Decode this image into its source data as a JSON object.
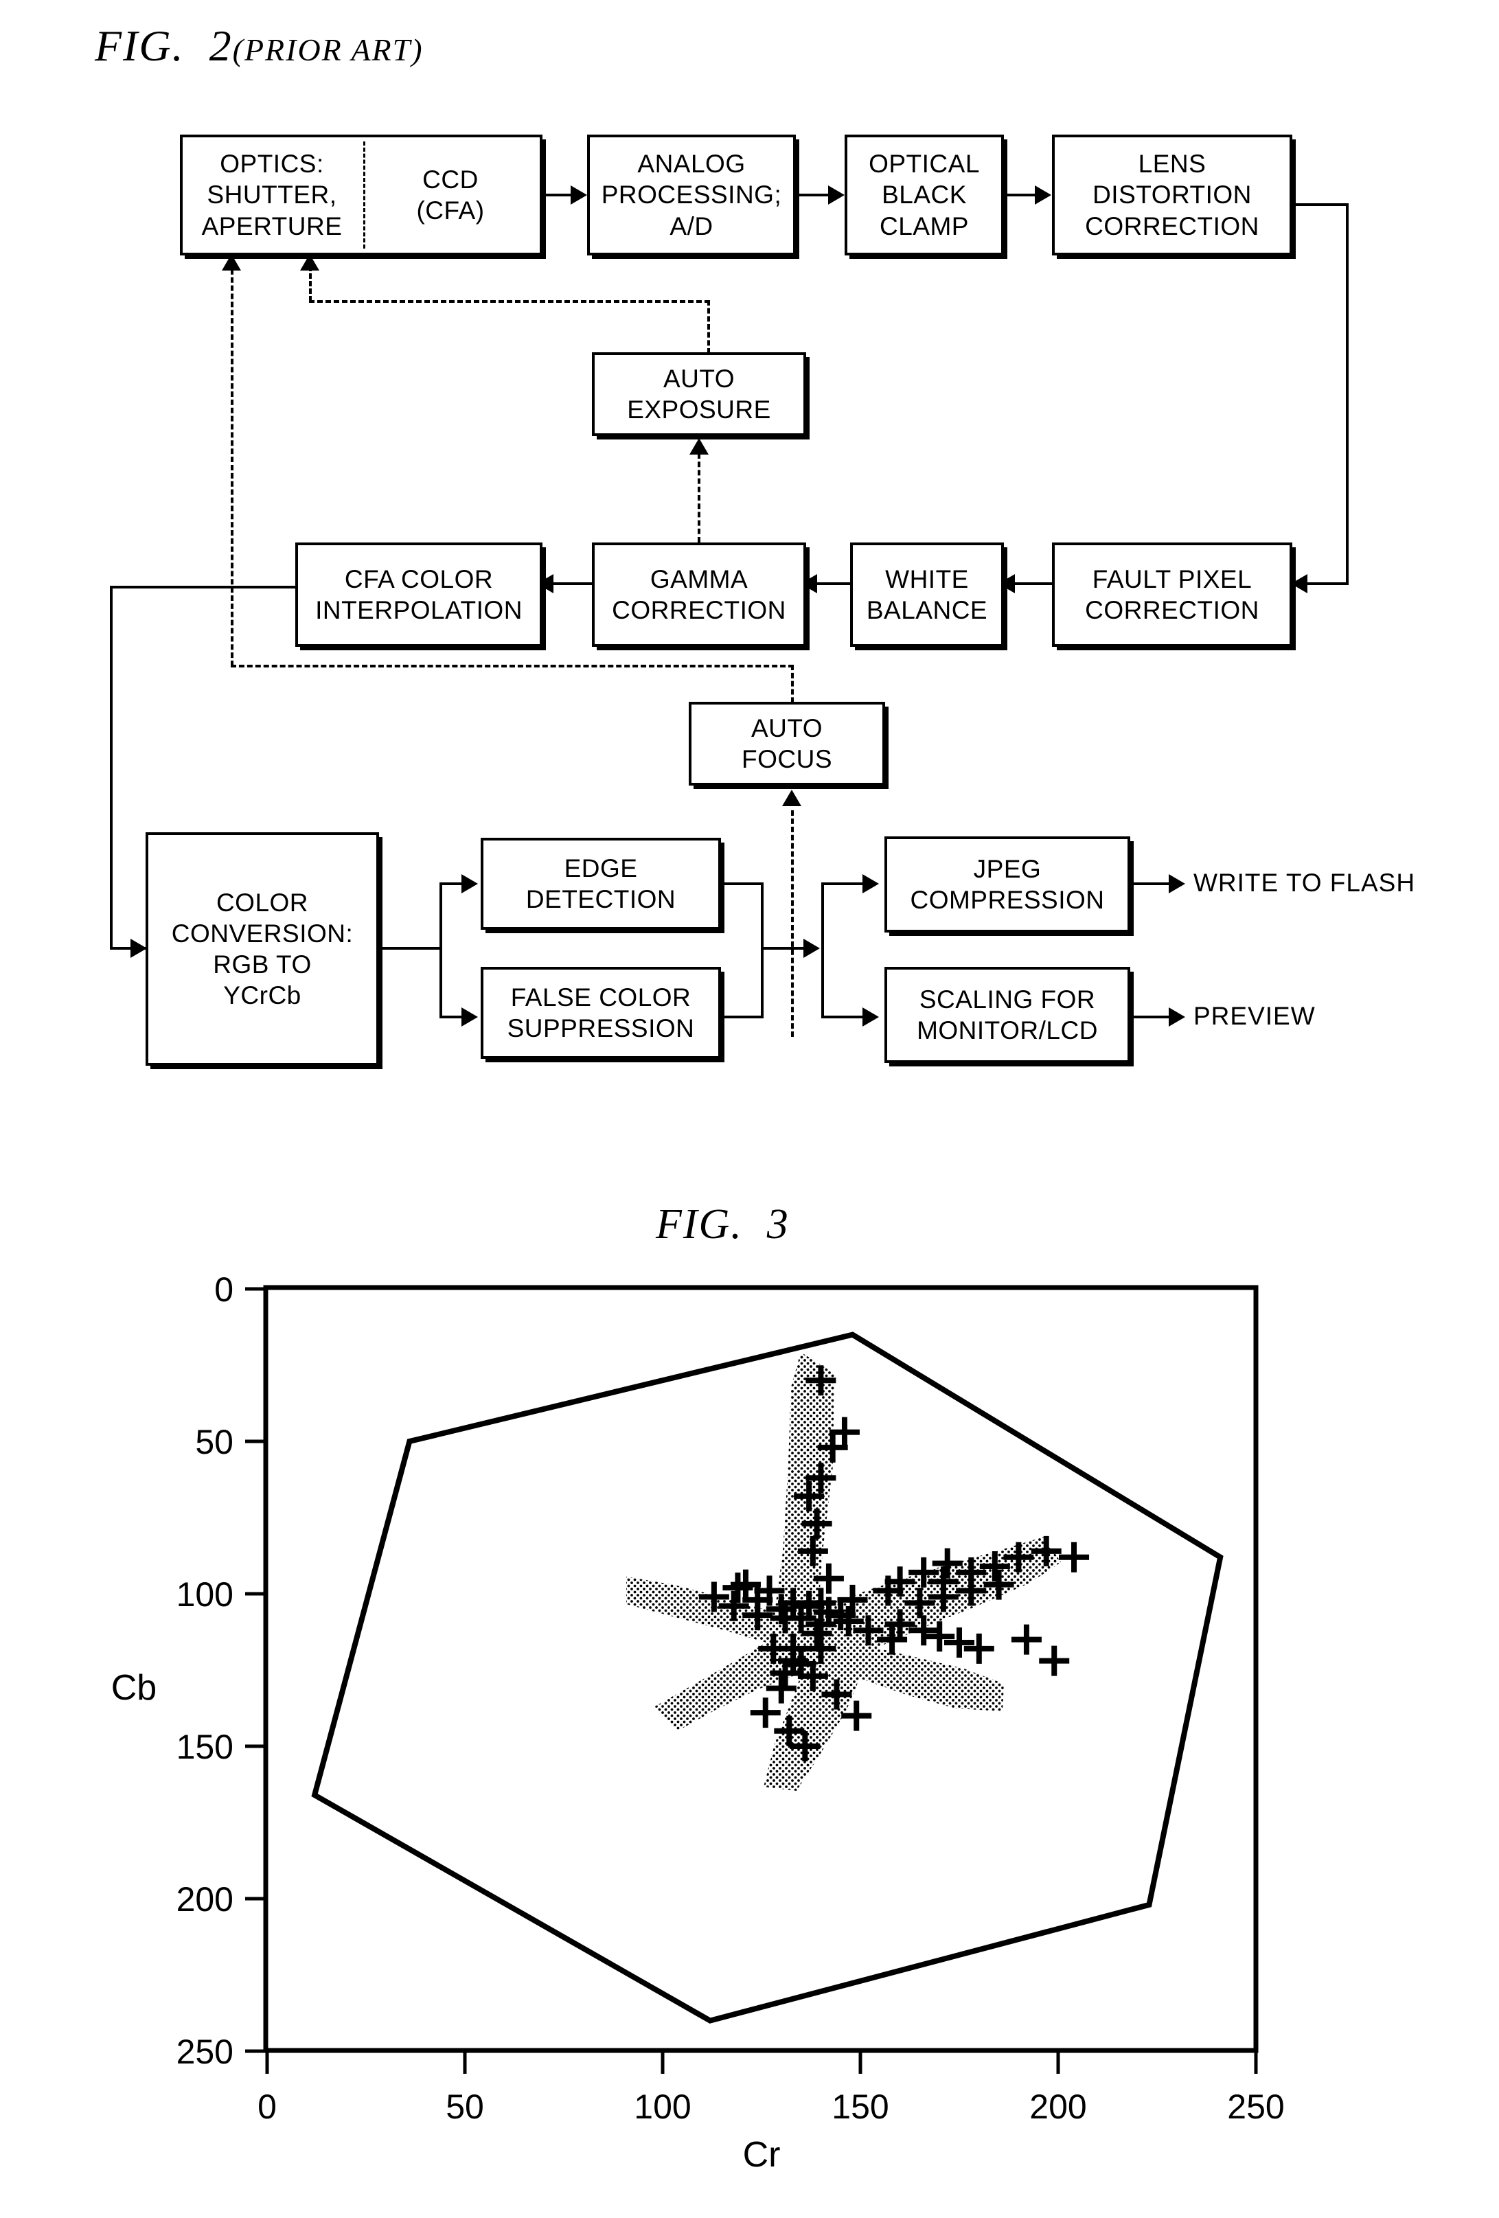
{
  "figure2": {
    "title": "FIG.  2",
    "title_suffix": "(PRIOR ART)",
    "nodes": {
      "optics": "OPTICS:\nSHUTTER,\nAPERTURE",
      "ccd": "CCD\n(CFA)",
      "analog": "ANALOG\nPROCESSING;\nA/D",
      "black_clamp": "OPTICAL\nBLACK\nCLAMP",
      "lens_distortion": "LENS\nDISTORTION\nCORRECTION",
      "auto_exposure": "AUTO\nEXPOSURE",
      "cfa_interp": "CFA COLOR\nINTERPOLATION",
      "gamma": "GAMMA\nCORRECTION",
      "white_balance": "WHITE\nBALANCE",
      "fault_pixel": "FAULT PIXEL\nCORRECTION",
      "auto_focus": "AUTO\nFOCUS",
      "color_conversion": "COLOR\nCONVERSION:\nRGB TO\nYCrCb",
      "edge_detection": "EDGE\nDETECTION",
      "false_color": "FALSE COLOR\nSUPPRESSION",
      "jpeg": "JPEG\nCOMPRESSION",
      "scaling": "SCALING FOR\nMONITOR/LCD"
    },
    "outputs": {
      "flash": "WRITE TO FLASH",
      "preview": "PREVIEW"
    }
  },
  "figure3": {
    "title": "FIG.  3"
  },
  "chart_data": {
    "type": "scatter",
    "title": "FIG.  3",
    "xlabel": "Cr",
    "ylabel": "Cb",
    "xlim": [
      0,
      260
    ],
    "ylim": [
      0,
      260
    ],
    "y_inverted": true,
    "grid": false,
    "legend": null,
    "xticks": [
      0,
      50,
      100,
      150,
      200,
      250
    ],
    "yticks": [
      0,
      50,
      100,
      150,
      200,
      250
    ],
    "xticklabels": [
      "0",
      "50",
      "100",
      "150",
      "200",
      "250"
    ],
    "yticklabels": [
      "0",
      "50",
      "100",
      "150",
      "200",
      "250"
    ],
    "annotations": [
      {
        "name": "gamut-hexagon",
        "type": "polygon",
        "closed": true,
        "points": [
          [
            148,
            15
          ],
          [
            241,
            88
          ],
          [
            223,
            202
          ],
          [
            112,
            240
          ],
          [
            12,
            166
          ],
          [
            36,
            50
          ]
        ]
      }
    ],
    "series": [
      {
        "name": "chroma-samples",
        "marker": "+",
        "x": [
          140,
          146,
          143,
          140,
          137,
          139,
          138,
          142,
          137,
          140,
          140,
          121,
          127,
          133,
          131,
          140,
          145,
          139,
          133,
          148,
          157,
          160,
          166,
          172,
          171,
          178,
          184,
          190,
          197,
          204,
          135,
          130,
          126,
          132,
          136,
          128,
          131,
          165,
          171,
          178,
          185,
          192,
          199,
          160,
          166,
          170,
          175,
          180,
          119,
          124,
          130,
          135,
          142,
          147,
          152,
          158,
          113,
          118,
          124,
          133,
          138,
          144,
          149
        ],
        "y": [
          30,
          47,
          52,
          62,
          68,
          77,
          86,
          95,
          104,
          110,
          118,
          97,
          99,
          103,
          108,
          103,
          107,
          113,
          118,
          102,
          99,
          96,
          93,
          90,
          96,
          93,
          91,
          88,
          86,
          88,
          123,
          131,
          139,
          145,
          150,
          118,
          126,
          103,
          101,
          99,
          97,
          115,
          122,
          110,
          112,
          114,
          116,
          118,
          98,
          102,
          105,
          108,
          106,
          109,
          112,
          115,
          101,
          104,
          107,
          122,
          127,
          133,
          140
        ]
      }
    ],
    "shaded_region": {
      "name": "star-shaped-stipple",
      "fill": "dotted-stipple",
      "description": "Five/six-armed star-shaped stippled region centered near (140,110)"
    }
  },
  "colors": {
    "ink": "#000000",
    "paper": "#ffffff"
  }
}
